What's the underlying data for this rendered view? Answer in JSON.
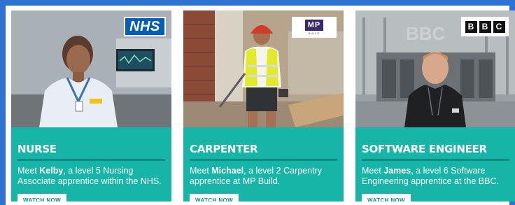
{
  "cards": [
    {
      "logo": "NHS",
      "title": "NURSE",
      "desc_pre": "Meet ",
      "name": "Kelby",
      "desc_post": ", a level 5 Nursing Associate apprentice within the NHS.",
      "cta": "WATCH NOW"
    },
    {
      "logo": "MP",
      "logo_sub": "BUILD",
      "title": "CARPENTER",
      "desc_pre": "Meet ",
      "name": "Michael",
      "desc_post": ", a level 2 Carpentry apprentice at MP Build.",
      "cta": "WATCH NOW"
    },
    {
      "logo_letters": [
        "B",
        "B",
        "C"
      ],
      "title": "SOFTWARE ENGINEER",
      "desc_pre": "Meet ",
      "name": "James",
      "desc_post": ", a level 6 Software Engineering apprentice at the BBC.",
      "cta": "WATCH NOW"
    }
  ],
  "colors": {
    "frame": "#2e72d2",
    "card": "#17b5a8",
    "button_text": "#0d8f85",
    "nhs_blue": "#005eb8",
    "mp_purple": "#3b2a6b"
  }
}
